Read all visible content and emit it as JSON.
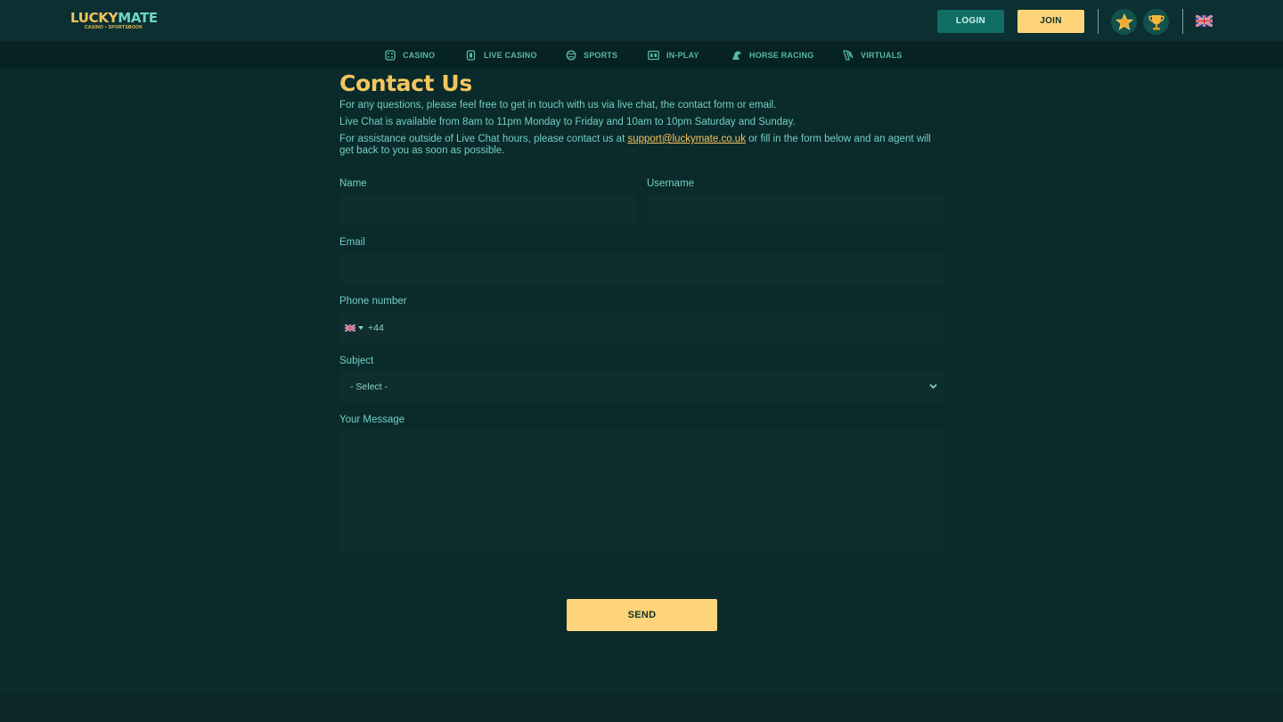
{
  "brand": {
    "logo_part1": "LUCKY",
    "logo_part2": "MATE",
    "tagline": "CASINO • SPORTSBOOK"
  },
  "header": {
    "login_label": "LOGIN",
    "join_label": "JOIN",
    "icons": [
      "star-badge-icon",
      "trophy-icon",
      "uk-flag-icon"
    ]
  },
  "nav": {
    "items": [
      {
        "label": "CASINO",
        "icon": "casino-icon"
      },
      {
        "label": "LIVE CASINO",
        "icon": "live-casino-icon"
      },
      {
        "label": "SPORTS",
        "icon": "sports-icon"
      },
      {
        "label": "IN-PLAY",
        "icon": "in-play-icon"
      },
      {
        "label": "HORSE RACING",
        "icon": "horse-racing-icon"
      },
      {
        "label": "VIRTUALS",
        "icon": "virtuals-icon"
      }
    ]
  },
  "content": {
    "title": "Contact Us",
    "intro1": "For any questions, please feel free to get in touch with us via live chat, the contact form or email.",
    "intro2": "Live Chat is available from 8am to 11pm Monday to Friday and 10am to 10pm Saturday and Sunday.",
    "intro3_before": "For assistance outside of Live Chat hours, please contact us at ",
    "support_email": "support@luckymate.co.uk",
    "intro3_after": " or fill in the form below and an agent will get back to you as soon as possible."
  },
  "form": {
    "name_label": "Name",
    "name_value": "",
    "username_label": "Username",
    "username_value": "",
    "email_label": "Email",
    "email_value": "",
    "phone_label": "Phone number",
    "phone_prefix": "+44",
    "phone_value": "",
    "subject_label": "Subject",
    "subject_selected": "- Select -",
    "message_label": "Your Message",
    "message_value": "",
    "send_label": "SEND"
  },
  "colors": {
    "background": "#0b2a2b",
    "header": "#0c2f31",
    "nav": "#072223",
    "accent_gold": "#fed47a",
    "title_gold": "#f2c65e",
    "login_teal": "#0f6e63",
    "text_teal": "#72cfc3",
    "field_bg": "#0f2d2f"
  }
}
